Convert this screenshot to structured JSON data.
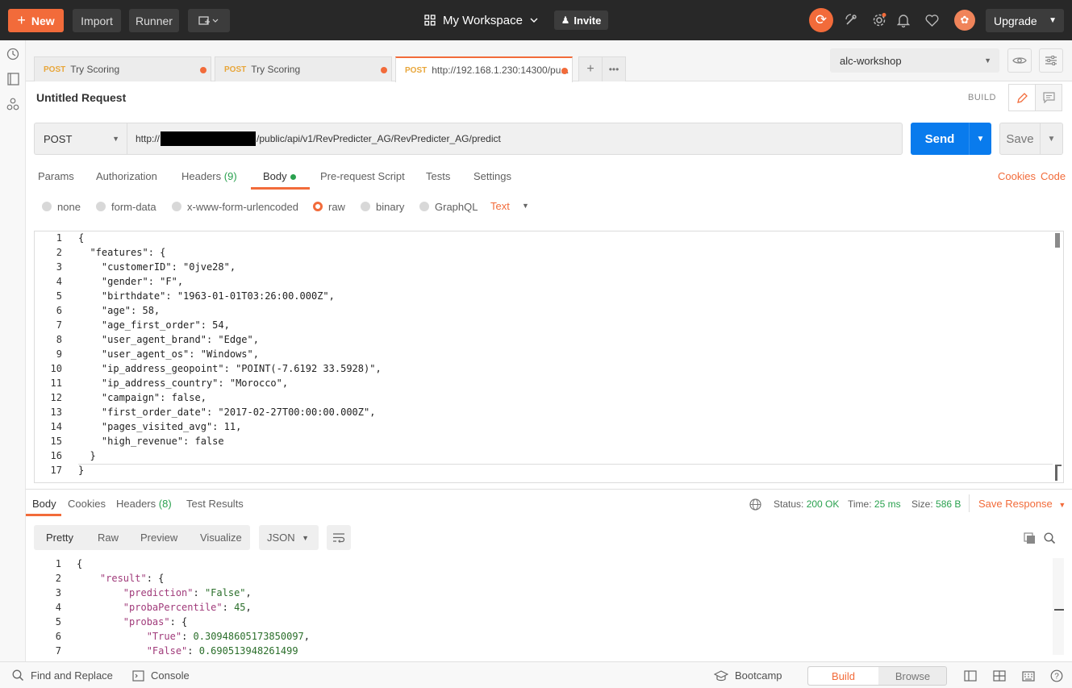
{
  "topbar": {
    "new_label": "New",
    "import_label": "Import",
    "runner_label": "Runner",
    "workspace_label": "My Workspace",
    "invite_label": "Invite",
    "upgrade_label": "Upgrade",
    "accent_color": "#f26b3a"
  },
  "tabs": [
    {
      "method": "POST",
      "label": "Try Scoring"
    },
    {
      "method": "POST",
      "label": "Try Scoring"
    },
    {
      "method": "POST",
      "label": "http://192.168.1.230:14300/pu..."
    }
  ],
  "environment": {
    "selected": "alc-workshop"
  },
  "request": {
    "title": "Untitled Request",
    "build_label": "BUILD",
    "method": "POST",
    "url_prefix": "http://",
    "url_suffix": "/public/api/v1/RevPredicter_AG/RevPredicter_AG/predict",
    "send_label": "Send",
    "save_label": "Save",
    "tabs": {
      "params": "Params",
      "authorization": "Authorization",
      "headers": "Headers",
      "headers_count": "(9)",
      "body": "Body",
      "prerequest": "Pre-request Script",
      "tests": "Tests",
      "settings": "Settings"
    },
    "cookies_link": "Cookies",
    "code_link": "Code",
    "body_types": {
      "none": "none",
      "form_data": "form-data",
      "urlencoded": "x-www-form-urlencoded",
      "raw": "raw",
      "binary": "binary",
      "graphql": "GraphQL"
    },
    "raw_format": "Text",
    "body_lines": [
      "{",
      "  \"features\": {",
      "    \"customerID\": \"0jve28\",",
      "    \"gender\": \"F\",",
      "    \"birthdate\": \"1963-01-01T03:26:00.000Z\",",
      "    \"age\": 58,",
      "    \"age_first_order\": 54,",
      "    \"user_agent_brand\": \"Edge\",",
      "    \"user_agent_os\": \"Windows\",",
      "    \"ip_address_geopoint\": \"POINT(-7.6192 33.5928)\",",
      "    \"ip_address_country\": \"Morocco\",",
      "    \"campaign\": false,",
      "    \"first_order_date\": \"2017-02-27T00:00:00.000Z\",",
      "    \"pages_visited_avg\": 11,",
      "    \"high_revenue\": false",
      "  }",
      "}"
    ]
  },
  "response": {
    "tabs": {
      "body": "Body",
      "cookies": "Cookies",
      "headers": "Headers",
      "headers_count": "(8)",
      "test_results": "Test Results"
    },
    "status_label": "Status:",
    "status_value": "200 OK",
    "time_label": "Time:",
    "time_value": "25 ms",
    "size_label": "Size:",
    "size_value": "586 B",
    "save_response": "Save Response",
    "view_tabs": {
      "pretty": "Pretty",
      "raw": "Raw",
      "preview": "Preview",
      "visualize": "Visualize"
    },
    "format": "JSON",
    "body_lines": [
      "{",
      "    \"result\": {",
      "        \"prediction\": \"False\",",
      "        \"probaPercentile\": 45,",
      "        \"probas\": {",
      "            \"True\": 0.30948605173850097,",
      "            \"False\": 0.690513948261499"
    ]
  },
  "footer": {
    "find_replace": "Find and Replace",
    "console": "Console",
    "bootcamp": "Bootcamp",
    "build": "Build",
    "browse": "Browse"
  }
}
